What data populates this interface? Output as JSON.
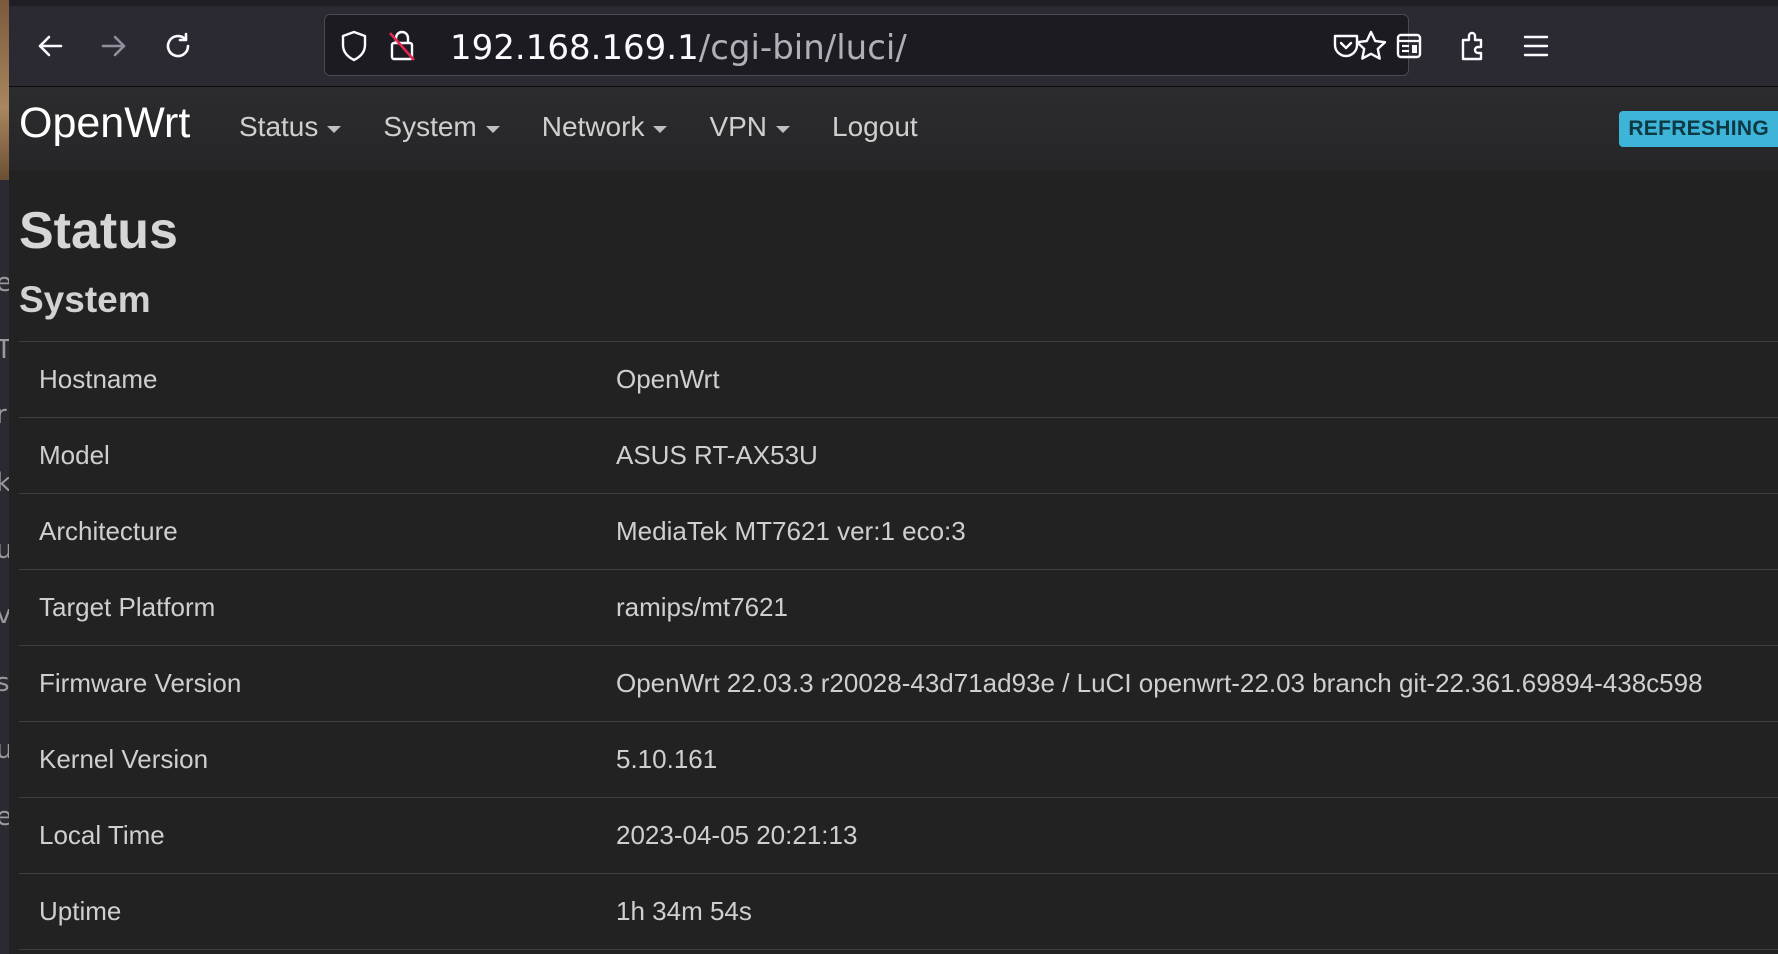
{
  "browser": {
    "url_host": "192.168.169.1",
    "url_path": "/cgi-bin/luci/",
    "icons": [
      "back-arrow-icon",
      "forward-arrow-icon",
      "reload-icon",
      "shield-icon",
      "insecure-lock-icon",
      "bookmark-star-icon",
      "pocket-icon",
      "reader-view-icon",
      "extensions-icon",
      "menu-icon"
    ]
  },
  "header": {
    "brand": "OpenWrt",
    "nav": [
      {
        "label": "Status",
        "dropdown": true
      },
      {
        "label": "System",
        "dropdown": true
      },
      {
        "label": "Network",
        "dropdown": true
      },
      {
        "label": "VPN",
        "dropdown": true
      },
      {
        "label": "Logout",
        "dropdown": false
      }
    ],
    "badge": "REFRESHING",
    "badge_color": "#3db4d8"
  },
  "page": {
    "title": "Status",
    "section": "System",
    "rows": [
      {
        "label": "Hostname",
        "value": "OpenWrt"
      },
      {
        "label": "Model",
        "value": "ASUS RT-AX53U"
      },
      {
        "label": "Architecture",
        "value": "MediaTek MT7621 ver:1 eco:3"
      },
      {
        "label": "Target Platform",
        "value": "ramips/mt7621"
      },
      {
        "label": "Firmware Version",
        "value": "OpenWrt 22.03.3 r20028-43d71ad93e / LuCI openwrt-22.03 branch git-22.361.69894-438c598"
      },
      {
        "label": "Kernel Version",
        "value": "5.10.161"
      },
      {
        "label": "Local Time",
        "value": "2023-04-05 20:21:13"
      },
      {
        "label": "Uptime",
        "value": "1h 34m 54s"
      }
    ]
  }
}
